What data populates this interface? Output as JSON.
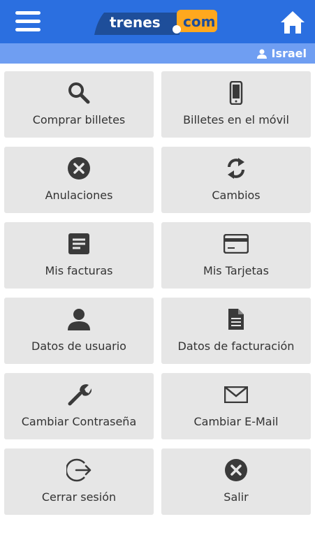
{
  "header": {
    "logo_text_left": "trenes",
    "logo_text_right": "com"
  },
  "userbar": {
    "user_name": "Israel"
  },
  "colors": {
    "header": "#2b6fe0",
    "userbar": "#6f9ef2",
    "tile": "#e6e6e6",
    "icon": "#3a3a3a",
    "logo_blue": "#1e4e9a",
    "logo_orange": "#ffa81e"
  },
  "menu": [
    {
      "label": "Comprar billetes",
      "icon": "search-icon"
    },
    {
      "label": "Billetes en el móvil",
      "icon": "mobile-phone-icon"
    },
    {
      "label": "Anulaciones",
      "icon": "close-circle-icon"
    },
    {
      "label": "Cambios",
      "icon": "refresh-icon"
    },
    {
      "label": "Mis facturas",
      "icon": "document-lines-icon"
    },
    {
      "label": "Mis Tarjetas",
      "icon": "credit-card-icon"
    },
    {
      "label": "Datos de usuario",
      "icon": "user-icon"
    },
    {
      "label": "Datos de facturación",
      "icon": "file-icon"
    },
    {
      "label": "Cambiar Contraseña",
      "icon": "wrench-icon"
    },
    {
      "label": "Cambiar E-Mail",
      "icon": "envelope-icon"
    },
    {
      "label": "Cerrar sesión",
      "icon": "logout-icon"
    },
    {
      "label": "Salir",
      "icon": "exit-icon"
    }
  ]
}
